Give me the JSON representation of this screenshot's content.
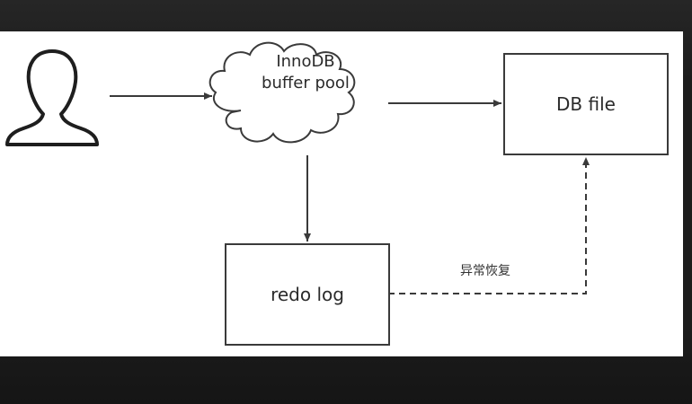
{
  "diagram": {
    "nodes": {
      "user": {
        "icon": "user-icon"
      },
      "buffer_pool": {
        "label_line1": "InnoDB",
        "label_line2": "buffer pool"
      },
      "db_file": {
        "label": "DB file"
      },
      "redo_log": {
        "label": "redo log"
      }
    },
    "edges": {
      "recovery_label": "异常恢复"
    }
  },
  "colors": {
    "background": "#1f1f1f",
    "canvas": "#ffffff",
    "stroke": "#3a3a3a"
  }
}
